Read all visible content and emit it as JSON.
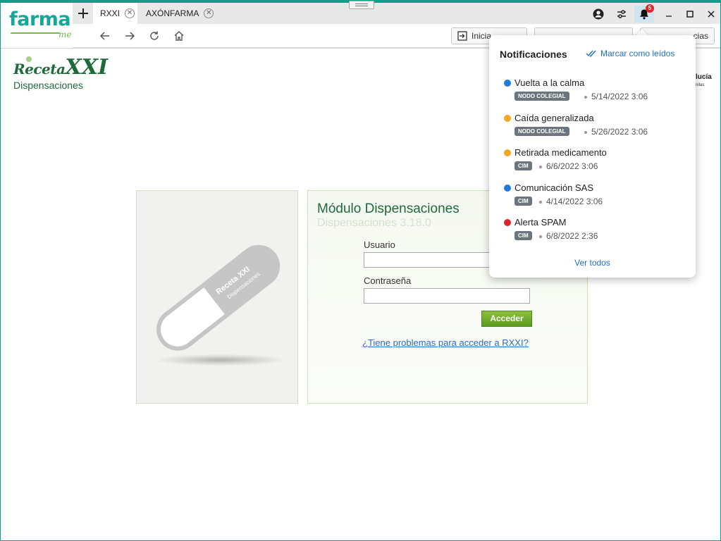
{
  "app": {
    "brand": "farma",
    "brand_sub": "me"
  },
  "tabs": [
    {
      "label": "RXXI",
      "active": true
    },
    {
      "label": "AXÓNFARMA",
      "active": false
    }
  ],
  "toolbar": {
    "notification_count": "5"
  },
  "nav": {
    "inicio_label": "Inicia",
    "btn2_label": "",
    "btn3_label": "cias"
  },
  "page": {
    "logo_receta": "Receta",
    "logo_xxi": "XXI",
    "logo_sub": "Dispensaciones",
    "right_brand": "lucía",
    "right_brand_sub": "nilas"
  },
  "login": {
    "title": "Módulo Dispensaciones",
    "version": "Dispensaciones 3.18.0",
    "user_label": "Usuario",
    "user_value": "",
    "password_label": "Contraseña",
    "password_value": "",
    "submit_label": "Acceder",
    "help_link": "¿Tiene problemas para acceder a RXXI?"
  },
  "pill": {
    "text1": "Receta XXI",
    "text2": "Dispensaciones"
  },
  "notifications": {
    "title": "Notificaciones",
    "mark_read": "Marcar como leídos",
    "see_all": "Ver todos",
    "items": [
      {
        "title": "Vuelta a la calma",
        "tag": "NODO COLEGIAL",
        "date": "5/14/2022 3:06",
        "color": "#1f7ae0"
      },
      {
        "title": "Caída generalizada",
        "tag": "NODO COLEGIAL",
        "date": "5/26/2022 3:06",
        "color": "#f5a623"
      },
      {
        "title": "Retirada medicamento",
        "tag": "CIM",
        "date": "6/6/2022 3:06",
        "color": "#f5a623"
      },
      {
        "title": "Comunicación SAS",
        "tag": "CIM",
        "date": "4/14/2022 3:06",
        "color": "#1f7ae0"
      },
      {
        "title": "Alerta SPAM",
        "tag": "CIM",
        "date": "6/8/2022 2:36",
        "color": "#e0242c"
      }
    ]
  }
}
